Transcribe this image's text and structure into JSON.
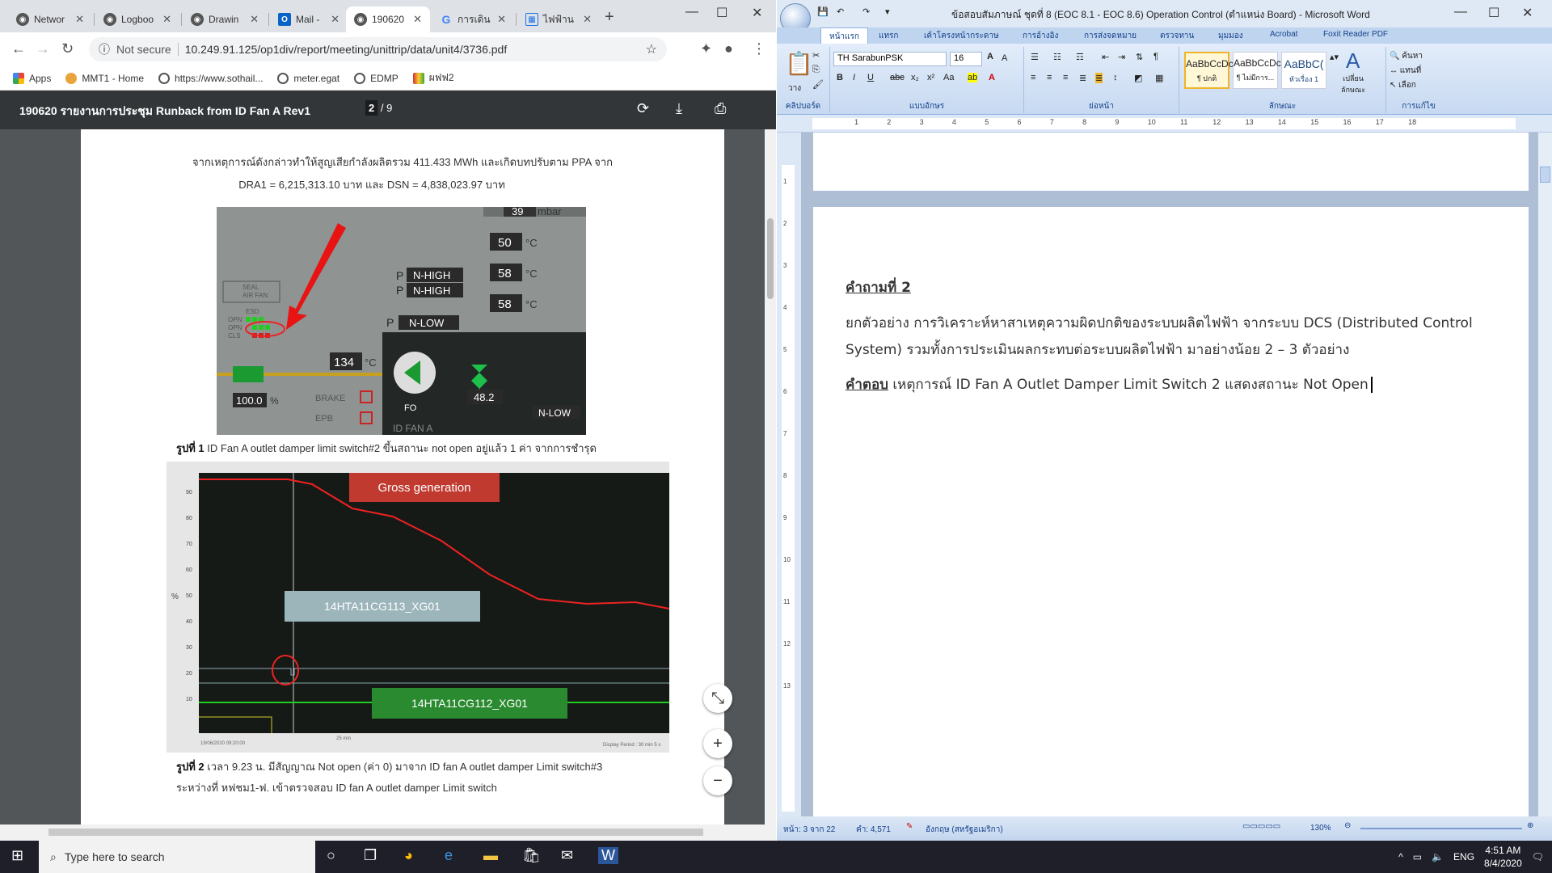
{
  "browser": {
    "tabs": [
      {
        "title": "Networ",
        "icon": "network-icon"
      },
      {
        "title": "Logboo",
        "icon": "globe-icon"
      },
      {
        "title": "Drawin",
        "icon": "globe-icon"
      },
      {
        "title": "Mail - ",
        "icon": "outlook-icon"
      },
      {
        "title": "190620",
        "icon": "globe-icon",
        "active": true
      },
      {
        "title": "การเดิน",
        "icon": "google-icon"
      },
      {
        "title": "ไฟฟ้าน",
        "icon": "table-icon"
      }
    ],
    "security": "Not secure",
    "url": "10.249.91.125/op1div/report/meeting/unittrip/data/unit4/3736.pdf",
    "bookmarks": [
      "Apps",
      "MMT1 - Home",
      "https://www.sothail...",
      "meter.egat",
      "EDMP",
      "ผฟฟ2"
    ]
  },
  "pdf": {
    "title": "190620 รายงานการประชุม Runback from ID Fan A Rev1",
    "page_current": "2",
    "page_total": "/ 9",
    "para1": "จากเหตุการณ์ดังกล่าวทำให้สูญเสียกำลังผลิตรวม 411.433 MWh และเกิดบทปรับตาม PPA จาก",
    "para2": "DRA1 = 6,215,313.10 บาท และ DSN = 4,838,023.97 บาท",
    "fig1_label": "รูปที่ 1",
    "fig1_caption": "ID Fan A outlet damper limit switch#2 ขึ้นสถานะ not open อยู่แล้ว 1 ค่า จากการชำรุด",
    "fig1": {
      "mbar": "39",
      "mbar_unit": "mbar",
      "temp1": "50",
      "temp2": "58",
      "temp3": "58",
      "temp_unit": "°C",
      "p_label": "P",
      "state1": "N-HIGH",
      "state2": "N-HIGH",
      "state3": "N-LOW",
      "state4": "N-LOW",
      "seal": "SEAL\nAIR FAN",
      "esd": "ESD",
      "opn": "OPN",
      "opn2": "OPN",
      "cls": "CLS",
      "temp4": "134",
      "pct": "100.0",
      "pct_unit": "%",
      "brake": "BRAKE",
      "epb": "EPB",
      "fo": "FO",
      "fan_label": "ID FAN A",
      "flow": "48.2"
    },
    "fig2_label": "รูปที่ 2",
    "fig2_caption_l1": "เวลา 9.23 น. มีสัญญาณ Not open (ค่า 0) มาจาก ID fan A outlet damper Limit switch#3",
    "fig2_caption_l2": "ระหว่างที่ หฟชม1-ฟ. เข้าตรวจสอบ ID fan A outlet damper Limit switch",
    "fig2": {
      "legend_gross": "Gross generation",
      "legend_113": "14HTA11CG113_XG01",
      "legend_112": "14HTA11CG112_XG01",
      "y_unit": "%",
      "y_ticks": [
        "90",
        "80",
        "70",
        "60",
        "50",
        "40",
        "30",
        "20",
        "10"
      ],
      "date": "19/06/2020 09:20:00",
      "x_tick": "25 min",
      "display": "Display Period : 30 min 5 s"
    }
  },
  "word": {
    "title": "ข้อสอบสัมภาษณ์ ชุดที่ 8 (EOC 8.1 - EOC 8.6) Operation Control (ตำแหน่ง Board) - Microsoft Word",
    "tabs": [
      "หน้าแรก",
      "แทรก",
      "เค้าโครงหน้ากระดาษ",
      "การอ้างอิง",
      "การส่งจดหมาย",
      "ตรวจทาน",
      "มุมมอง",
      "Acrobat",
      "Foxit Reader PDF"
    ],
    "font": "TH SarabunPSK",
    "size": "16",
    "groups": [
      "คลิปบอร์ด",
      "แบบอักษร",
      "ย่อหน้า",
      "ลักษณะ",
      "การแก้ไข"
    ],
    "paste": "วาง",
    "styles": [
      {
        "sample": "AaBbCcDc",
        "name": "¶ ปกติ"
      },
      {
        "sample": "AaBbCcDc",
        "name": "¶ ไม่มีการ..."
      },
      {
        "sample": "AaBbC(",
        "name": "หัวเรื่อง 1"
      }
    ],
    "change_styles": "เปลี่ยน\nลักษณะ",
    "edit": [
      "ค้นหา",
      "แทนที่",
      "เลือก"
    ],
    "ruler": [
      "1",
      "2",
      "3",
      "4",
      "5",
      "6",
      "7",
      "8",
      "9",
      "10",
      "11",
      "12",
      "13",
      "14",
      "15",
      "16",
      "17",
      "18"
    ],
    "vruler": [
      "1",
      "2",
      "3",
      "4",
      "5",
      "6",
      "7",
      "8",
      "9",
      "10",
      "11",
      "12",
      "13"
    ],
    "question": "คำถามที่ 2",
    "q_line1": "ยกตัวอย่าง การวิเคราะห์หาสาเหตุความผิดปกติของระบบผลิตไฟฟ้า จากระบบ DCS (Distributed Control",
    "q_line2": "System) รวมทั้งการประเมินผลกระทบต่อระบบผลิตไฟฟ้า มาอย่างน้อย 2 – 3 ตัวอย่าง",
    "answer_label": "คำตอบ",
    "answer_text": "เหตุการณ์ ID Fan A Outlet Damper Limit Switch 2 แสดงสถานะ Not Open",
    "status_page": "หน้า: 3 จาก 22",
    "status_words": "คำ: 4,571",
    "status_lang": "อังกฤษ (สหรัฐอเมริกา)",
    "zoom": "130%"
  },
  "taskbar": {
    "search": "Type here to search",
    "lang": "ENG",
    "time": "4:51 AM",
    "date": "8/4/2020"
  }
}
